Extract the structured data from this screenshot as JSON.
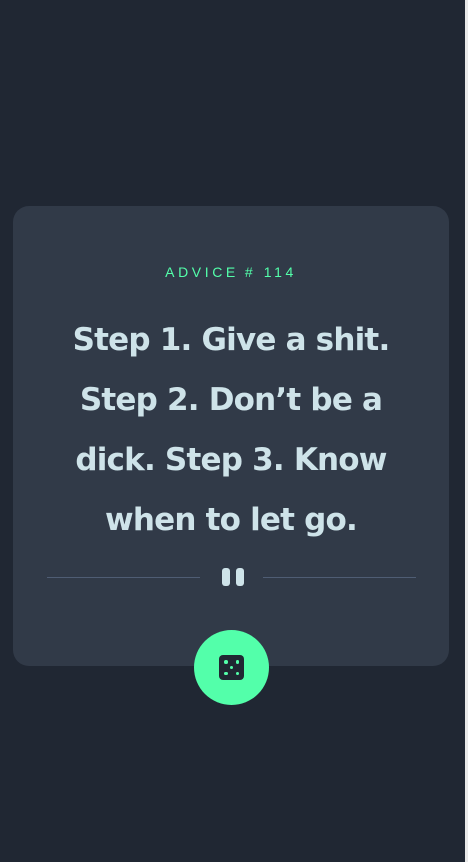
{
  "advice": {
    "label": "ADVICE",
    "number": "# 114",
    "text": "Step 1. Give a shit. Step 2. Don’t be a dick. Step 3. Know when to let go."
  },
  "colors": {
    "page_bg": "#202733",
    "card_bg": "#313a48",
    "accent": "#53ffaa",
    "text": "#cee3e9",
    "divider": "#4f5d74"
  },
  "icons": {
    "divider": "pause-icon",
    "button": "dice-icon"
  }
}
